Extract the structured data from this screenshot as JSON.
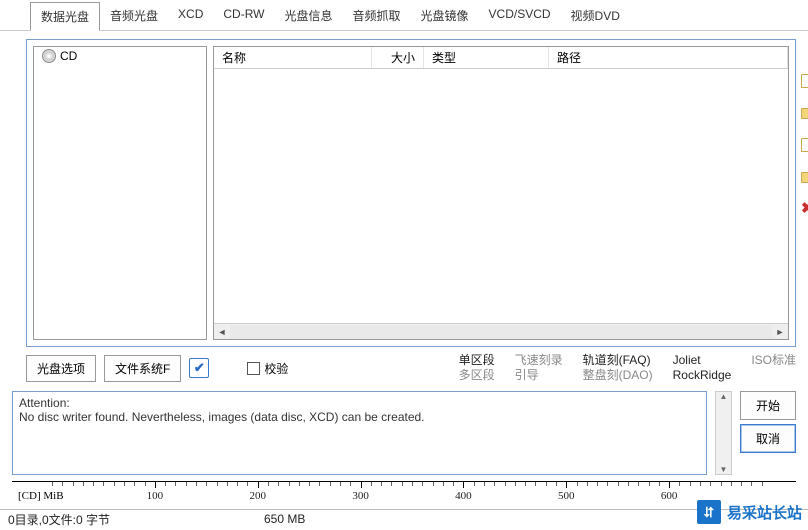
{
  "tabs": [
    "数据光盘",
    "音频光盘",
    "XCD",
    "CD-RW",
    "光盘信息",
    "音频抓取",
    "光盘镜像",
    "VCD/SVCD",
    "视频DVD"
  ],
  "tree": {
    "root": "CD"
  },
  "columns": {
    "name": "名称",
    "size": "大小",
    "type": "类型",
    "path": "路径"
  },
  "buttons": {
    "disc_options": "光盘选项",
    "filesystem": "文件系统F",
    "verify": "校验",
    "start": "开始",
    "cancel": "取消"
  },
  "options": {
    "c1a": "单区段",
    "c1b": "多区段",
    "c2a": "飞速刻录",
    "c2b": "引导",
    "c3a": "轨道刻(FAQ)",
    "c3b": "整盘刻(DAO)",
    "c4a": "Joliet",
    "c4b": "RockRidge",
    "c5a": "ISO标准"
  },
  "message": {
    "line1": "Attention:",
    "line2": "No disc writer found. Nevertheless, images (data disc, XCD) can be created."
  },
  "ruler": {
    "label": "[CD] MiB",
    "ticks": [
      "100",
      "200",
      "300",
      "400",
      "500",
      "600"
    ]
  },
  "status": {
    "left": "0目录,0文件:0 字节",
    "right": "650 MB"
  },
  "watermark": {
    "text": "易采站长站"
  }
}
